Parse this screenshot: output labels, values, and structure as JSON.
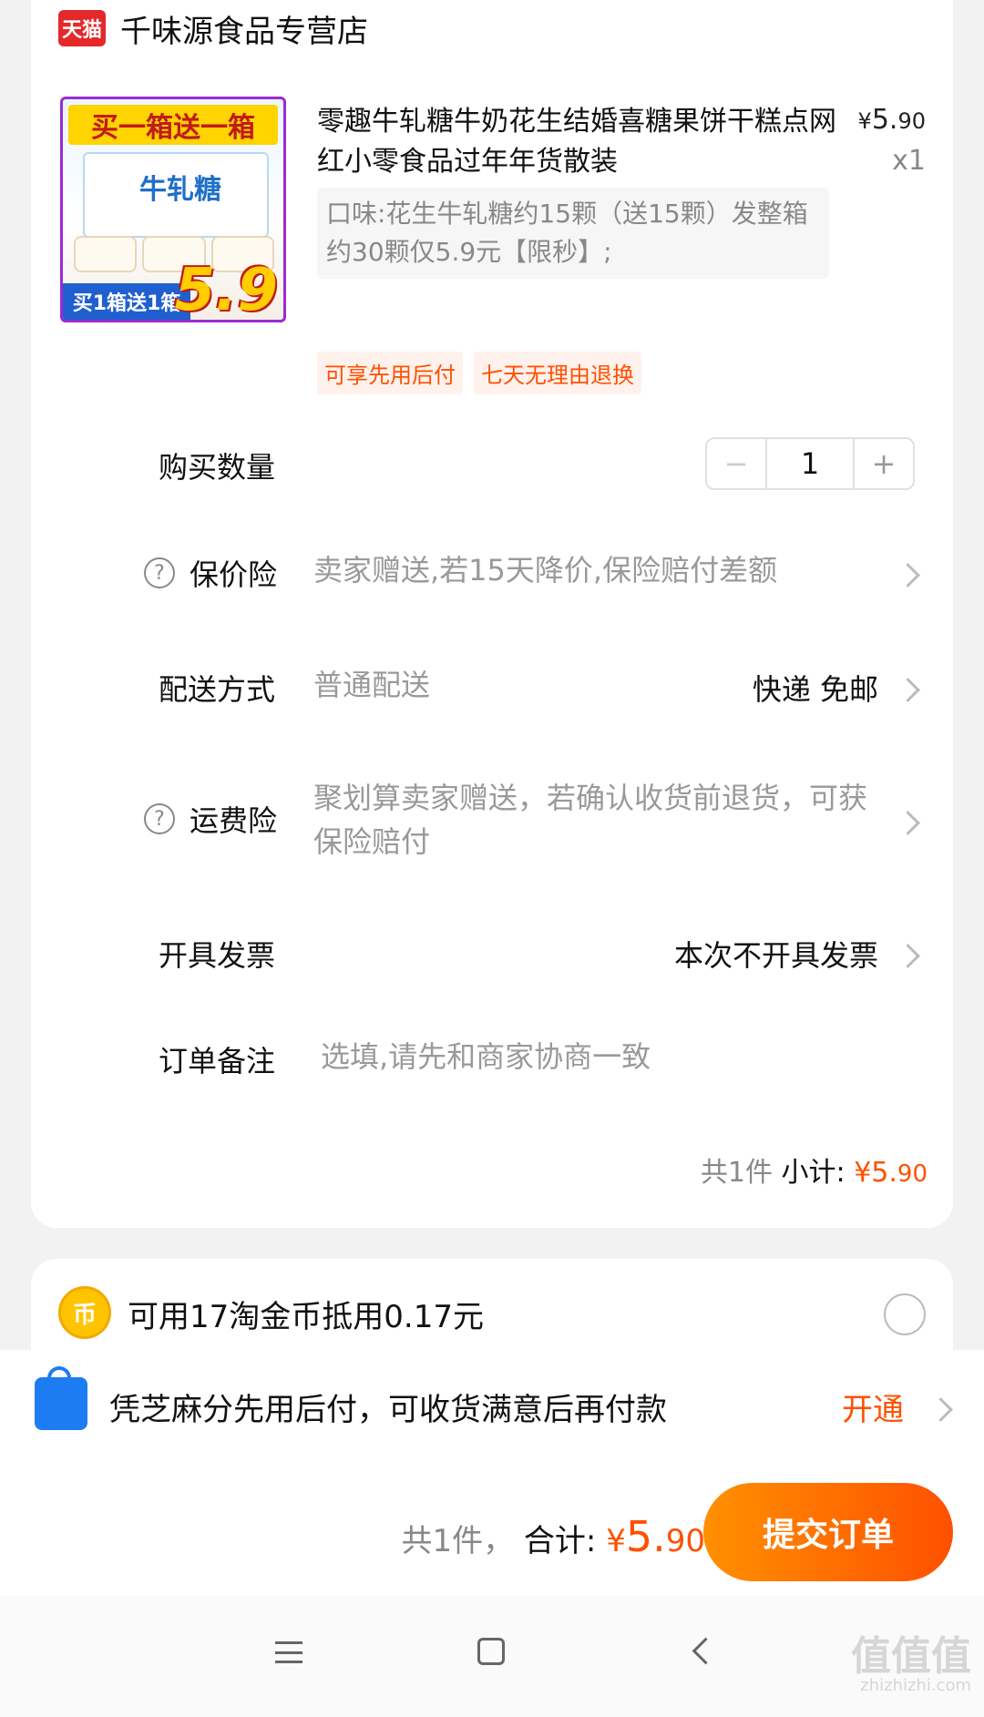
{
  "shop": {
    "badge": "天猫",
    "name": "千味源食品专营店"
  },
  "product": {
    "title": "零趣牛轧糖牛奶花生结婚喜糖果饼干糕点网红小零食品过年年货散装",
    "currency": "¥",
    "price_int": "5.",
    "price_dec": "90",
    "quantity_label": "x1",
    "spec": "口味:花生牛轧糖约15颗（送15颗）发整箱约30颗仅5.9元【限秒】;",
    "image_text": {
      "top": "买一箱送一箱",
      "box": "牛轧糖",
      "bottom": "买1箱送1箱",
      "price": "5.9"
    },
    "tags": [
      "可享先用后付",
      "七天无理由退换"
    ]
  },
  "purchase": {
    "label": "购买数量",
    "minus": "−",
    "value": "1",
    "plus": "+"
  },
  "price_protect": {
    "label": "保价险",
    "value": "卖家赠送,若15天降价,保险赔付差额"
  },
  "delivery": {
    "label": "配送方式",
    "value": "普通配送",
    "right": "快递 免邮"
  },
  "shipping_insurance": {
    "label": "运费险",
    "value": "聚划算卖家赠送，若确认收货前退货，可获保险赔付"
  },
  "invoice": {
    "label": "开具发票",
    "right": "本次不开具发票"
  },
  "note": {
    "label": "订单备注",
    "placeholder": "选填,请先和商家协商一致"
  },
  "subtotal": {
    "count": "共1件",
    "label": "小计:",
    "currency": "¥",
    "int": "5.",
    "dec": "90"
  },
  "coins": {
    "icon": "币",
    "text": "可用17淘金币抵用0.17元"
  },
  "sesame": {
    "text": "凭芝麻分先用后付，可收货满意后再付款",
    "action": "开通"
  },
  "footer": {
    "count": "共1件，",
    "label": "合计:",
    "currency": "¥",
    "int": "5.",
    "dec": "90",
    "submit": "提交订单"
  },
  "watermark": {
    "text": "值值值",
    "url": "zhizhizhi.com"
  }
}
